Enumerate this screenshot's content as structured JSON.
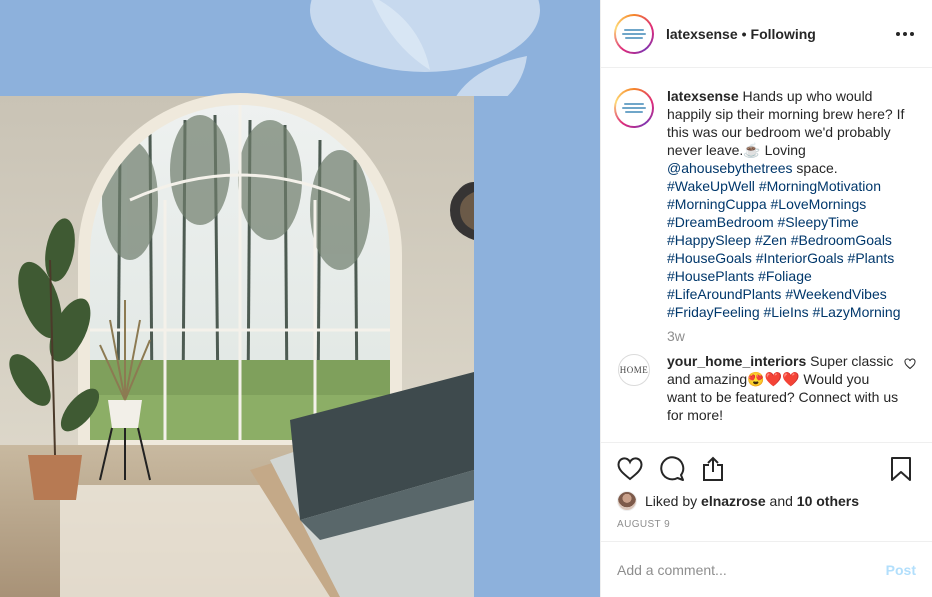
{
  "colors": {
    "image_background": "#8db1dc",
    "link": "#00376b",
    "muted": "#8e8e8e",
    "post_button": "#b2dffc"
  },
  "header": {
    "username": "latexsense",
    "separator": "•",
    "follow_status": "Following",
    "more_icon": "more-horizontal-icon"
  },
  "caption": {
    "username": "latexsense",
    "text_intro": "Hands up who would happily sip their morning brew here? If this was our bedroom we'd probably never leave.☕ Loving ",
    "mention": "@ahousebythetrees",
    "text_after_mention": " space.",
    "hashtags": [
      "#WakeUpWell",
      "#MorningMotivation",
      "#MorningCuppa",
      "#LoveMornings",
      "#DreamBedroom",
      "#SleepyTime",
      "#HappySleep",
      "#Zen",
      "#BedroomGoals",
      "#HouseGoals",
      "#InteriorGoals",
      "#Plants",
      "#HousePlants",
      "#Foliage",
      "#LifeAroundPlants",
      "#WeekendVibes",
      "#FridayFeeling",
      "#LieIns",
      "#LazyMorning"
    ],
    "time": "3w"
  },
  "reply": {
    "avatar_text": "HOME",
    "username": "your_home_interiors",
    "text": "Super classic and amazing😍❤️❤️ Would you want to be featured? Connect with us for more!"
  },
  "actions": {
    "like_icon": "heart-icon",
    "comment_icon": "comment-icon",
    "share_icon": "share-icon",
    "save_icon": "bookmark-icon"
  },
  "likes": {
    "prefix": "Liked by ",
    "user": "elnazrose",
    "middle": " and ",
    "others": "10 others"
  },
  "date": "AUGUST 9",
  "add_comment": {
    "placeholder": "Add a comment...",
    "post_label": "Post"
  }
}
